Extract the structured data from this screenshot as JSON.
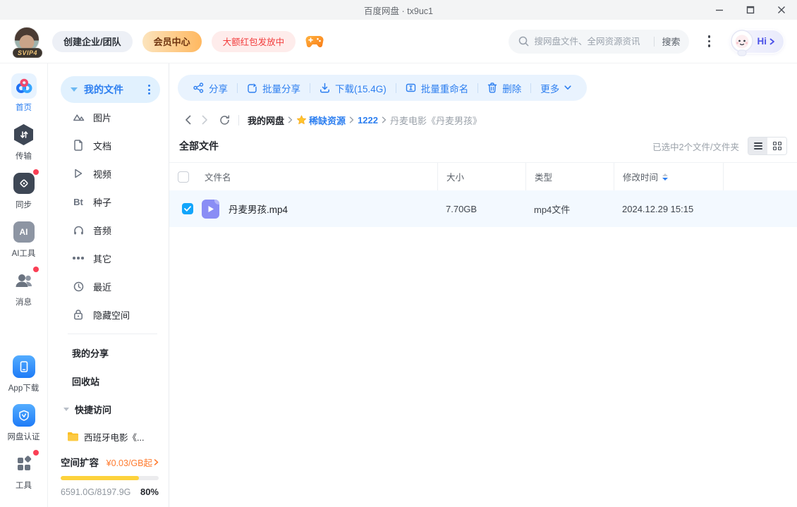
{
  "titlebar": {
    "title": "百度网盘 · tx9uc1"
  },
  "header": {
    "avatar_badge": "SVIP4",
    "create_team": "创建企业/团队",
    "vip_center": "会员中心",
    "red_packet": "大额红包发放中",
    "search_placeholder": "搜网盘文件、全网资源资讯",
    "search_button": "搜索",
    "assistant_label": "Hi"
  },
  "rail": {
    "items": [
      {
        "label": "首页"
      },
      {
        "label": "传输"
      },
      {
        "label": "同步"
      },
      {
        "label": "AI工具",
        "glyph": "AI"
      },
      {
        "label": "消息"
      }
    ],
    "bottom": [
      {
        "label": "App下载"
      },
      {
        "label": "网盘认证"
      },
      {
        "label": "工具"
      }
    ]
  },
  "sidebar": {
    "my_files": "我的文件",
    "tree": [
      {
        "label": "图片"
      },
      {
        "label": "文档"
      },
      {
        "label": "视频"
      },
      {
        "label": "种子",
        "glyph": "Bt"
      },
      {
        "label": "音频"
      },
      {
        "label": "其它"
      },
      {
        "label": "最近"
      },
      {
        "label": "隐藏空间"
      }
    ],
    "my_share": "我的分享",
    "recycle": "回收站",
    "quick_access": "快捷访问",
    "quick_folder": "西班牙电影《...",
    "storage": {
      "expand_label": "空间扩容",
      "price": "¥0.03/GB起",
      "usage": "6591.0G/8197.9G",
      "percent_label": "80%",
      "percent": "80%"
    }
  },
  "toolbar": {
    "share": "分享",
    "batch_share": "批量分享",
    "download": "下载(15.4G)",
    "batch_rename": "批量重命名",
    "delete": "删除",
    "more": "更多"
  },
  "breadcrumb": {
    "root": "我的网盘",
    "starred": "稀缺资源",
    "folder_num": "1222",
    "current": "丹麦电影《丹麦男孩》"
  },
  "filelist": {
    "section_title": "全部文件",
    "selection_info": "已选中2个文件/文件夹",
    "columns": {
      "name": "文件名",
      "size": "大小",
      "type": "类型",
      "modified": "修改时间"
    },
    "rows": [
      {
        "name": "丹麦男孩.mp4",
        "size": "7.70GB",
        "type": "mp4文件",
        "modified": "2024.12.29 15:15",
        "selected": true
      }
    ]
  },
  "colors": {
    "accent_blue": "#2d7ff0",
    "sky_blue": "#12a5fb",
    "badge_red": "#fa3f55",
    "vip_text": "#6e3410",
    "red_text": "#f23c3c",
    "orange": "#ff7b2f",
    "progress_yellow": "#fdd23c",
    "file_icon_purple": "#8a8df5",
    "folder_yellow": "#fbbf24"
  }
}
